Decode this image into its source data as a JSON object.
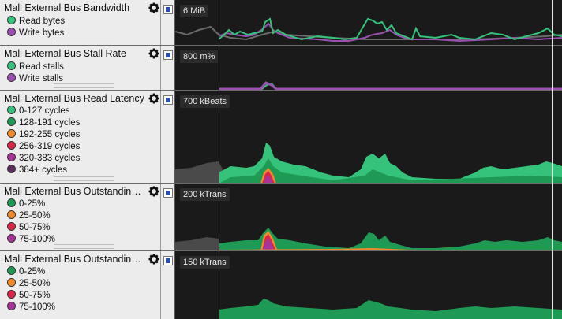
{
  "colors": {
    "green": "#35c27a",
    "darkgreen": "#1f9a55",
    "purple": "#9b4fb0",
    "orange": "#f08a2a",
    "red": "#d8274b",
    "magenta": "#a8349a",
    "darkpurple": "#5a2d5a",
    "gray": "#555555",
    "checkbox": "#2b4fa8"
  },
  "icons": {
    "settings": "gear-icon",
    "toggle": "checkbox-icon"
  },
  "rows": [
    {
      "title": "Mali External Bus Bandwidth",
      "scale": "6 MiB",
      "legend": [
        {
          "label": "Read bytes",
          "color": "#35c27a"
        },
        {
          "label": "Write bytes",
          "color": "#9b4fb0"
        }
      ]
    },
    {
      "title": "Mali External Bus Stall Rate",
      "scale": "800 m%",
      "legend": [
        {
          "label": "Read stalls",
          "color": "#35c27a"
        },
        {
          "label": "Write stalls",
          "color": "#9b4fb0"
        }
      ]
    },
    {
      "title": "Mali External Bus Read Latency",
      "scale": "700 kBeats",
      "legend": [
        {
          "label": "0-127 cycles",
          "color": "#35c27a"
        },
        {
          "label": "128-191 cycles",
          "color": "#1f9a55"
        },
        {
          "label": "192-255 cycles",
          "color": "#f08a2a"
        },
        {
          "label": "256-319 cycles",
          "color": "#d8274b"
        },
        {
          "label": "320-383 cycles",
          "color": "#a8349a"
        },
        {
          "label": "384+ cycles",
          "color": "#5a2d5a"
        }
      ]
    },
    {
      "title": "Mali External Bus Outstanding R…",
      "scale": "200 kTrans",
      "legend": [
        {
          "label": "0-25%",
          "color": "#1f9a55"
        },
        {
          "label": "25-50%",
          "color": "#f08a2a"
        },
        {
          "label": "50-75%",
          "color": "#d8274b"
        },
        {
          "label": "75-100%",
          "color": "#a8349a"
        }
      ]
    },
    {
      "title": "Mali External Bus Outstanding …",
      "scale": "150 kTrans",
      "legend": [
        {
          "label": "0-25%",
          "color": "#1f9a55"
        },
        {
          "label": "25-50%",
          "color": "#f08a2a"
        },
        {
          "label": "50-75%",
          "color": "#d8274b"
        },
        {
          "label": "75-100%",
          "color": "#a8349a"
        }
      ]
    }
  ]
}
